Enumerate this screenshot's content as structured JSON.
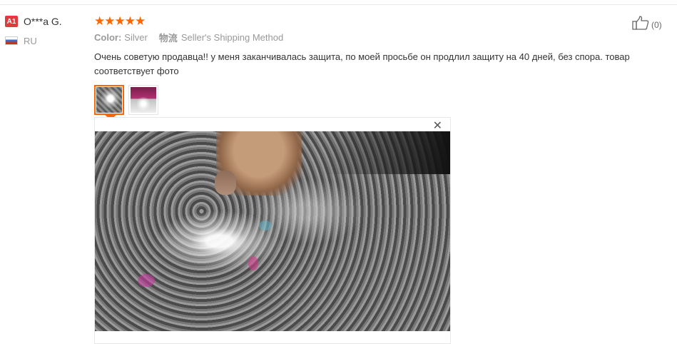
{
  "user": {
    "badge": "A1",
    "name": "O***a G.",
    "country": "RU",
    "flag_icon": "russia-flag-icon"
  },
  "review": {
    "rating": 5,
    "rating_color": "#ff6600",
    "color_label": "Color:",
    "color_value": "Silver",
    "shipping_cn": "物流",
    "shipping_value": "Seller's Shipping Method",
    "text": "Очень советую продавца!! у меня заканчивалась защита, по моей просьбе он продлил защиту на 40 дней, без спора. товар соответствует фото"
  },
  "photos": {
    "active_index": 0,
    "count": 2,
    "close_symbol": "✕"
  },
  "like": {
    "icon": "thumbs-up-icon",
    "count": "(0)"
  }
}
